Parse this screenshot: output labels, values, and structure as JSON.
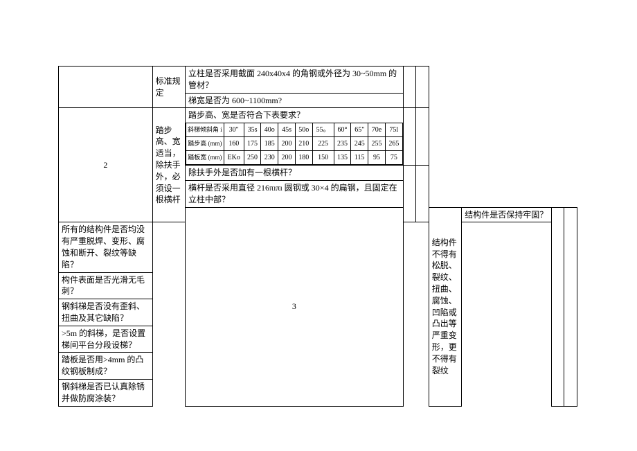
{
  "rows": [
    {
      "idx": "",
      "label": "标准规定",
      "questions": [
        "立柱是否采用截面 240x40x4 的角钢或外径为 30~50mm 的管材？",
        "梯宽是否为 600~1100mm?"
      ]
    },
    {
      "idx": "2",
      "label": "踏步高、宽适当，除扶手外，必须设一根横杆",
      "intro": "踏步高、宽是否符合下表要求？",
      "table": {
        "headers": [
          "斜梯倾斜角 i",
          "30\"",
          "35s",
          "40o",
          "45s",
          "50o",
          "55。",
          "60°",
          "65\"",
          "70e",
          "75l"
        ],
        "row1": [
          "踏步高 (mm)",
          "160",
          "175",
          "185",
          "200",
          "210",
          "225",
          "235",
          "245",
          "255",
          "265"
        ],
        "row2": [
          "踏板宽 (mm)",
          "EKo",
          "250",
          "230",
          "200",
          "180",
          "150",
          "135",
          "115",
          "95",
          "75"
        ]
      },
      "questions": [
        "除扶手外是否加有一根横杆？",
        "横杆是否采用直径 216πıπı 圆钢或 30×4 的扁钢，且固定在立柱中部？"
      ]
    },
    {
      "idx": "3",
      "label": "结构件不得有松脱、裂纹、扭曲、腐蚀、凹陷或凸出等严重变形，更不得有裂纹",
      "questions": [
        "结构件是否保持牢固？",
        "所有的结构件是否均没有严重脱焊、变形、腐蚀和断开、裂纹等缺陷？",
        "构件表面是否光滑无毛刺？",
        "钢斜梯是否没有歪斜、扭曲及其它缺陷？",
        ">5m 的斜梯，是否设置梯间平台分段设梯？",
        "踏板是否用>4mm 的凸纹钢板制成？",
        "钢斜梯是否已认真除锈并做防腐涂装？"
      ]
    }
  ]
}
